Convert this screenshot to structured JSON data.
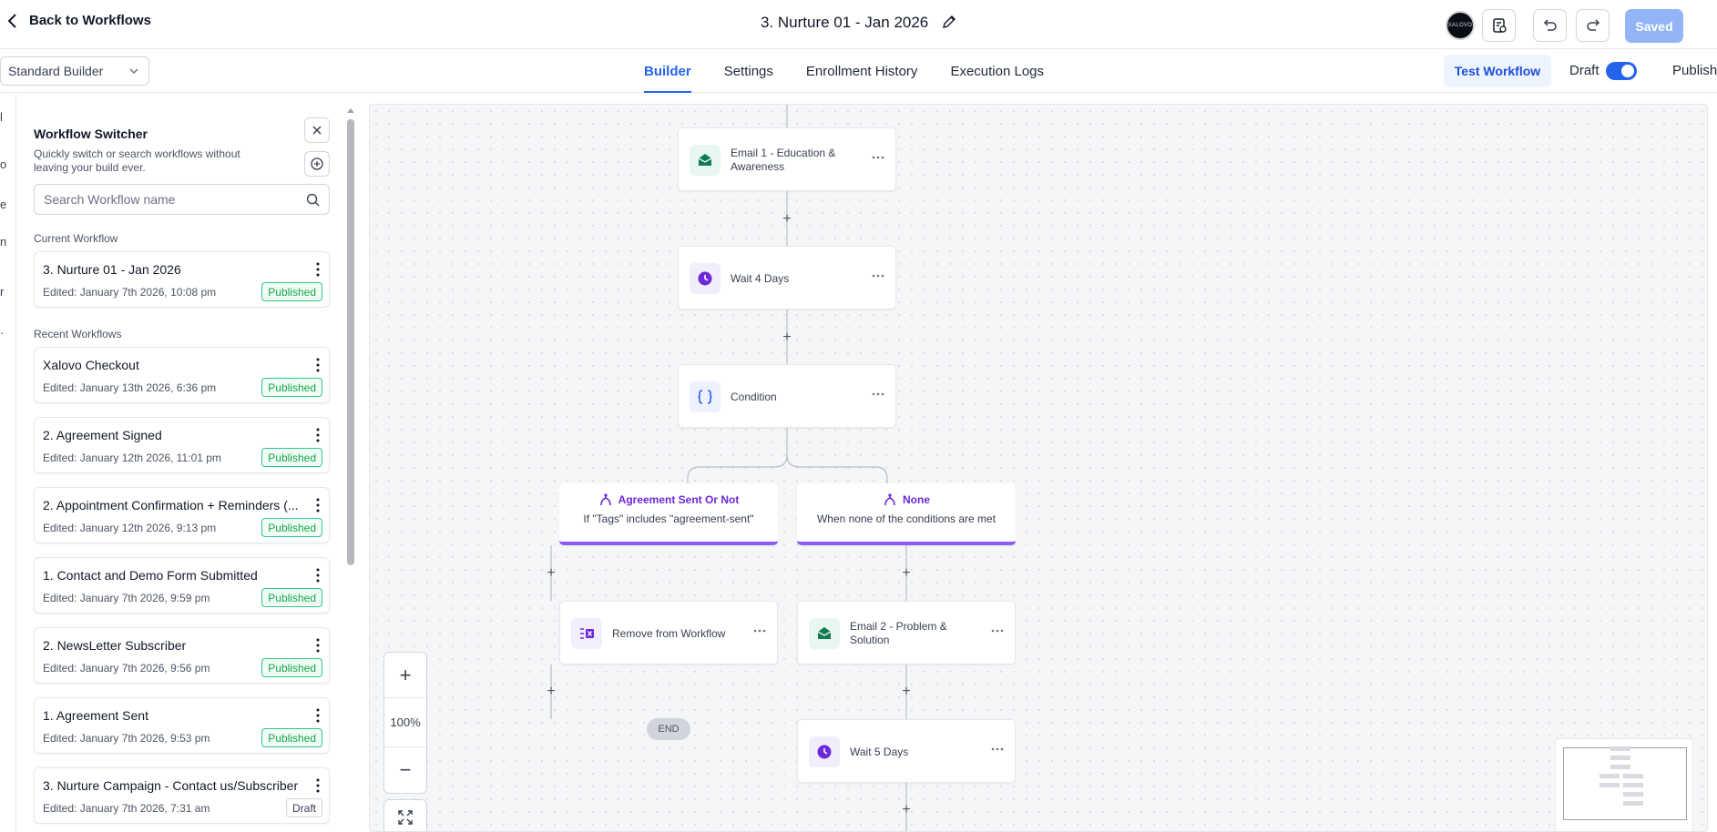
{
  "header": {
    "back_label": "Back to Workflows",
    "workflow_title": "3. Nurture 01 - Jan 2026",
    "avatar_text": "XALOVO",
    "saved_label": "Saved"
  },
  "toolbar": {
    "builder_mode": "Standard Builder",
    "tabs": [
      {
        "label": "Builder",
        "active": true
      },
      {
        "label": "Settings",
        "active": false
      },
      {
        "label": "Enrollment History",
        "active": false
      },
      {
        "label": "Execution Logs",
        "active": false
      }
    ],
    "test_workflow_label": "Test Workflow",
    "draft_label": "Draft",
    "publish_label": "Publish"
  },
  "left_strip_fragments": [
    "l",
    "o",
    "e",
    "n",
    "r",
    "·"
  ],
  "switcher": {
    "title": "Workflow Switcher",
    "subtitle": "Quickly switch or search workflows without leaving your build ever.",
    "search_placeholder": "Search Workflow name",
    "current_label": "Current Workflow",
    "current": {
      "name": "3. Nurture 01 - Jan 2026",
      "edited": "Edited: January 7th 2026, 10:08 pm",
      "status": "Published"
    },
    "recent_label": "Recent Workflows",
    "recent": [
      {
        "name": "Xalovo Checkout",
        "edited": "Edited: January 13th 2026, 6:36 pm",
        "status": "Published"
      },
      {
        "name": "2. Agreement Signed",
        "edited": "Edited: January 12th 2026, 11:01 pm",
        "status": "Published"
      },
      {
        "name": "2. Appointment Confirmation + Reminders (...",
        "edited": "Edited: January 12th 2026, 9:13 pm",
        "status": "Published"
      },
      {
        "name": "1. Contact and Demo Form Submitted",
        "edited": "Edited: January 7th 2026, 9:59 pm",
        "status": "Published"
      },
      {
        "name": "2. NewsLetter Subscriber",
        "edited": "Edited: January 7th 2026, 9:56 pm",
        "status": "Published"
      },
      {
        "name": "1. Agreement Sent",
        "edited": "Edited: January 7th 2026, 9:53 pm",
        "status": "Published"
      },
      {
        "name": "3. Nurture Campaign - Contact us/Subscriber",
        "edited": "Edited: January 7th 2026, 7:31 am",
        "status": "Draft"
      }
    ]
  },
  "canvas": {
    "nodes": {
      "email1": "Email 1 - Education & Awareness",
      "wait1": "Wait 4 Days",
      "condition": "Condition",
      "remove": "Remove from Workflow",
      "email2": "Email 2 - Problem & Solution",
      "wait2": "Wait 5 Days"
    },
    "branches": {
      "left": {
        "title": "Agreement Sent Or Not",
        "desc": "If \"Tags\" includes \"agreement-sent\""
      },
      "right": {
        "title": "None",
        "desc": "When none of the conditions are met"
      }
    },
    "end_label": "END",
    "plus_symbol": "+",
    "zoom": {
      "in_symbol": "+",
      "level": "100%",
      "out_symbol": "−"
    }
  },
  "colors": {
    "accent": "#2563eb",
    "published": "#16a34a",
    "branch": "#8b5cf6",
    "saved_bg": "#93b4f6"
  }
}
